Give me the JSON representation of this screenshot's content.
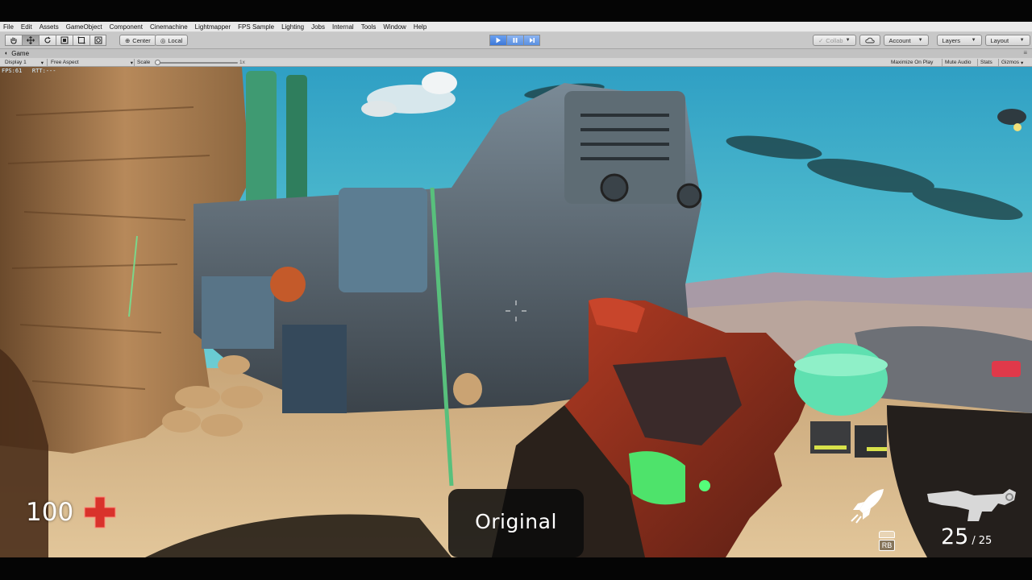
{
  "menu": [
    "File",
    "Edit",
    "Assets",
    "GameObject",
    "Component",
    "Cinemachine",
    "Lightmapper",
    "FPS Sample",
    "Lighting",
    "Jobs",
    "Internal",
    "Tools",
    "Window",
    "Help"
  ],
  "toolbar": {
    "pivot_label": "Center",
    "space_label": "Local",
    "collab_label": "Collab",
    "account_label": "Account",
    "layers_label": "Layers",
    "layout_label": "Layout"
  },
  "game_tab": {
    "title": "Game"
  },
  "game_bar": {
    "display": "Display 1",
    "aspect": "Free Aspect",
    "scale_label": "Scale",
    "scale_value": "1x",
    "maximize_on_play": "Maximize On Play",
    "mute_audio": "Mute Audio",
    "stats": "Stats",
    "gizmos": "Gizmos"
  },
  "game": {
    "fps_readout": "FPS:61   RTT:---",
    "health": "100",
    "badge_text": "Original",
    "ammo_current": "25",
    "ammo_separator": "/",
    "ammo_max": "25",
    "ability_button": "RB"
  },
  "colors": {
    "health_cross": "#d9322b",
    "sky": "#4fb3cf",
    "sand": "#d4b487",
    "play_button": "#3d78d8"
  },
  "icons": [
    "hand-tool-icon",
    "move-tool-icon",
    "rotate-tool-icon",
    "scale-tool-icon",
    "rect-tool-icon",
    "transform-tool-icon",
    "play-icon",
    "pause-icon",
    "step-icon",
    "cloud-icon",
    "settings-icon",
    "health-cross-icon",
    "rocket-icon",
    "weapon-icon"
  ]
}
